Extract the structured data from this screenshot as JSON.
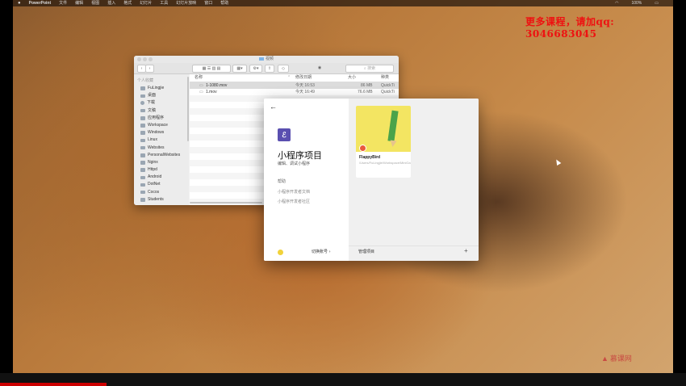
{
  "menubar": {
    "apple": "",
    "items": [
      "PowerPoint",
      "文件",
      "编辑",
      "视图",
      "插入",
      "格式",
      "幻灯片",
      "工具",
      "幻灯片放映",
      "窗口",
      "帮助"
    ],
    "battery": "100%"
  },
  "watermark": "更多课程，请加qq: 3046683045",
  "brand_logo": "慕课网",
  "finder": {
    "title": "视频",
    "search_placeholder": "搜索",
    "nav_back": "‹",
    "nav_forward": "›",
    "sidebar_section": "个人收藏",
    "sidebar_items": [
      {
        "label": "FuLingjie",
        "icon": "home-icon"
      },
      {
        "label": "桌面",
        "icon": "desktop-icon"
      },
      {
        "label": "下载",
        "icon": "download-icon"
      },
      {
        "label": "文稿",
        "icon": "document-icon"
      },
      {
        "label": "应用程序",
        "icon": "applications-icon"
      },
      {
        "label": "Workspace",
        "icon": "folder-icon"
      },
      {
        "label": "Windows",
        "icon": "folder-icon"
      },
      {
        "label": "Linux",
        "icon": "folder-icon"
      },
      {
        "label": "Websites",
        "icon": "folder-icon"
      },
      {
        "label": "PersonalWebsites",
        "icon": "folder-icon"
      },
      {
        "label": "Nginx",
        "icon": "folder-icon"
      },
      {
        "label": "Httpd",
        "icon": "folder-icon"
      },
      {
        "label": "Android",
        "icon": "folder-icon"
      },
      {
        "label": "DotNet",
        "icon": "folder-icon"
      },
      {
        "label": "Cocos",
        "icon": "folder-icon"
      },
      {
        "label": "Students",
        "icon": "folder-icon"
      }
    ],
    "columns": {
      "name": "名称",
      "date": "修改日期",
      "size": "大小",
      "kind": "种类"
    },
    "files": [
      {
        "name": "1-1080.mov",
        "date": "今天 16:53",
        "size": "86 MB",
        "kind": "QuickTi"
      },
      {
        "name": "1.mov",
        "date": "今天 16:49",
        "size": "76.6 MB",
        "kind": "QuickTi"
      }
    ]
  },
  "dialog": {
    "back": "←",
    "app_icon": "mini-program-icon",
    "title": "小程序项目",
    "subtitle": "编辑、调试小程序",
    "help_label": "帮助",
    "help_links": [
      "小程序开发者文档",
      "小程序开发者社区"
    ],
    "switch_account": "切换账号",
    "switch_arrow": "›",
    "project": {
      "name": "FlappyBird",
      "path": "/Users/FuLingjie/Workspace/MiniGame/FlappyBird"
    },
    "manage_label": "管理项目",
    "add": "+"
  }
}
